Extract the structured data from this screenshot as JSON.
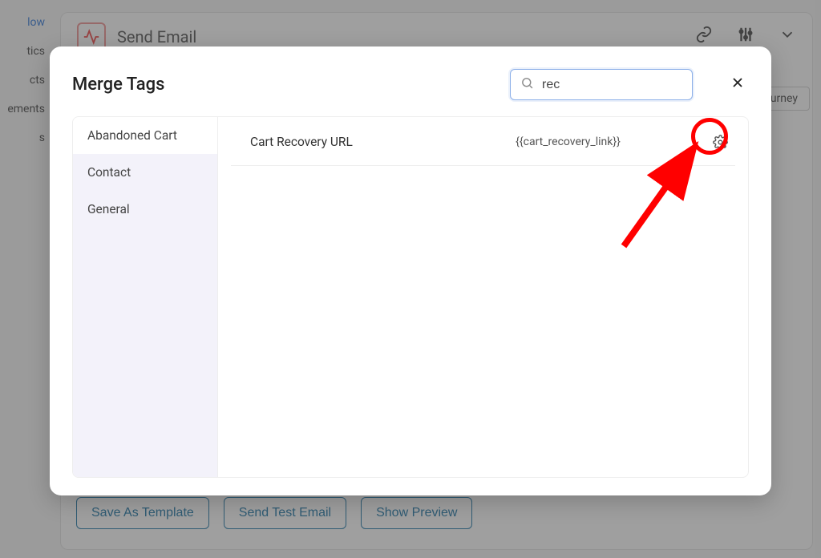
{
  "sidebar": {
    "items": [
      {
        "label": "low",
        "active": true
      },
      {
        "label": "tics"
      },
      {
        "label": "cts"
      },
      {
        "label": "ements"
      },
      {
        "label": "s"
      }
    ]
  },
  "card": {
    "title": "Send Email",
    "journey_btn": "urney"
  },
  "buttons": {
    "save_template": "Save As Template",
    "send_test": "Send Test Email",
    "show_preview": "Show Preview"
  },
  "modal": {
    "title": "Merge Tags",
    "search_value": "rec",
    "tabs": [
      {
        "label": "Abandoned Cart",
        "active": true
      },
      {
        "label": "Contact"
      },
      {
        "label": "General"
      }
    ],
    "rows": [
      {
        "label": "Cart Recovery URL",
        "tag": "{{cart_recovery_link}}"
      }
    ]
  }
}
